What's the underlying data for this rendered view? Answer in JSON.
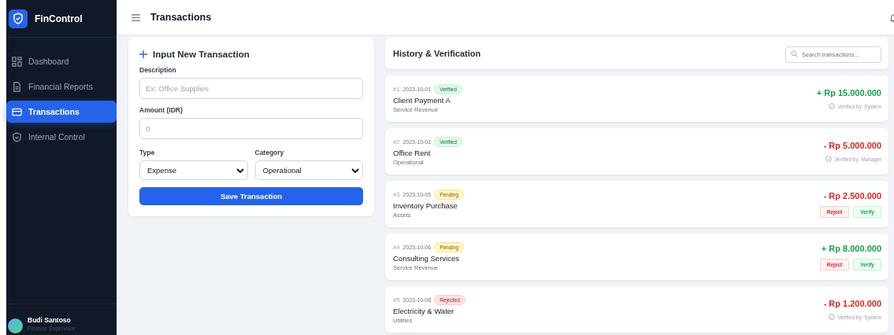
{
  "brand": {
    "name": "FinControl"
  },
  "sidebar": {
    "items": [
      {
        "label": "Dashboard",
        "selected": false
      },
      {
        "label": "Financial Reports",
        "selected": false
      },
      {
        "label": "Transactions",
        "selected": true
      },
      {
        "label": "Internal Control",
        "selected": false
      }
    ],
    "user": {
      "name": "Budi Santoso",
      "role": "Finance Supervisor"
    }
  },
  "header": {
    "title": "Transactions"
  },
  "form": {
    "title": "Input New Transaction",
    "description": {
      "label": "Description",
      "placeholder": "Ex: Office Supplies"
    },
    "amount": {
      "label": "Amount (IDR)",
      "placeholder": "0"
    },
    "type": {
      "label": "Type",
      "value": "Expense"
    },
    "category": {
      "label": "Category",
      "value": "Operational"
    },
    "submit": "Save Transaction"
  },
  "history": {
    "title": "History & Verification",
    "search": {
      "placeholder": "Search transactions..."
    },
    "transactions": [
      {
        "number": "#1",
        "date": "2023-10-01",
        "status": {
          "label": "Verified",
          "kind": "verified"
        },
        "name": "Client Payment A",
        "category": "Service Revenue",
        "amount": "+ Rp 15.000.000",
        "kind": "income",
        "verified_by": "Verified by: System"
      },
      {
        "number": "#2",
        "date": "2023-10-02",
        "status": {
          "label": "Verified",
          "kind": "verified"
        },
        "name": "Office Rent",
        "category": "Operational",
        "amount": "- Rp 5.000.000",
        "kind": "expense",
        "verified_by": "Verified by: Manager"
      },
      {
        "number": "#3",
        "date": "2023-10-05",
        "status": {
          "label": "Pending",
          "kind": "pending"
        },
        "name": "Inventory Purchase",
        "category": "Assets",
        "amount": "- Rp 2.500.000",
        "kind": "expense",
        "actions": [
          "Reject",
          "Verify"
        ]
      },
      {
        "number": "#4",
        "date": "2023-10-06",
        "status": {
          "label": "Pending",
          "kind": "pending"
        },
        "name": "Consulting Services",
        "category": "Service Revenue",
        "amount": "+ Rp 8.000.000",
        "kind": "income",
        "actions": [
          "Reject",
          "Verify"
        ]
      },
      {
        "number": "#5",
        "date": "2023-10-08",
        "status": {
          "label": "Rejected",
          "kind": "rejected"
        },
        "name": "Electricity & Water",
        "category": "Utilities",
        "amount": "- Rp 1.200.000",
        "kind": "expense",
        "verified_by": "Verified by: System"
      }
    ]
  }
}
